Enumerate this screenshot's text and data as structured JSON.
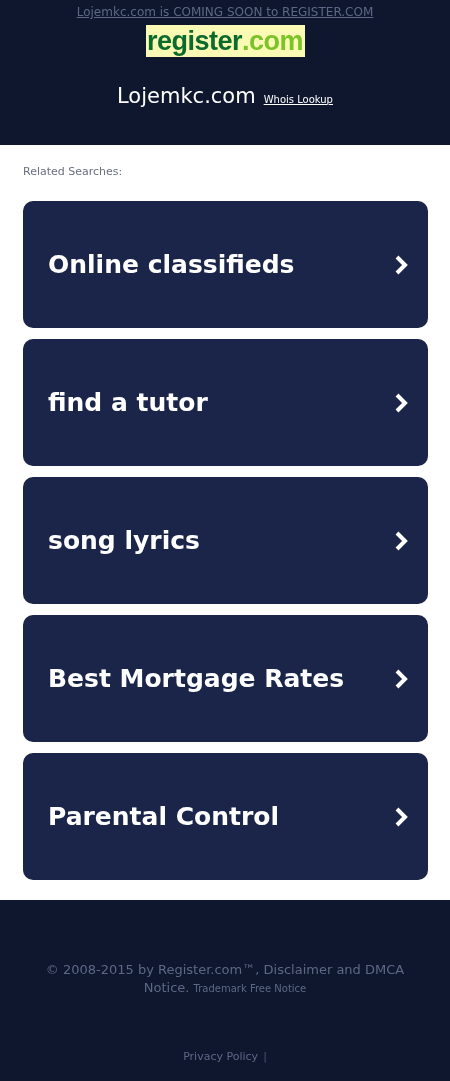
{
  "header": {
    "notice_link": "Lojemkc.com is COMING SOON to REGISTER.COM",
    "logo": {
      "name": "register",
      "tld": ".com"
    },
    "domain": "Lojemkc.com",
    "whois_link": "Whois Lookup"
  },
  "related": {
    "heading": "Related Searches:",
    "items": [
      {
        "label": "Online classifieds"
      },
      {
        "label": "find a tutor"
      },
      {
        "label": "song lyrics"
      },
      {
        "label": "Best Mortgage Rates"
      },
      {
        "label": "Parental Control"
      }
    ]
  },
  "footer": {
    "copyright": "© 2008-2015 by Register.com™, Disclaimer and DMCA Notice.",
    "trademark_link": "Trademark Free Notice",
    "privacy_link": "Privacy Policy",
    "separator": "|"
  }
}
